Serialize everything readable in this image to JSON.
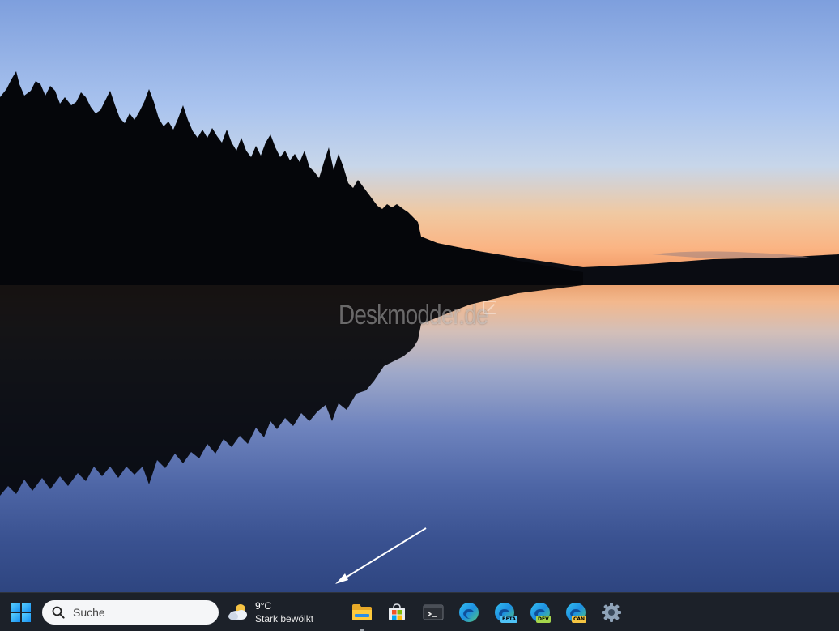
{
  "wallpaper": {
    "watermark": "Deskmodder.de",
    "colors": {
      "sky_top": "#7e9fdd",
      "horizon": "#f4a06c",
      "water_bottom": "#2e4580"
    }
  },
  "taskbar": {
    "background": "#1c2129",
    "start": {
      "icon": "windows-logo-icon"
    },
    "search": {
      "placeholder": "Suche",
      "icon": "search-icon"
    },
    "weather": {
      "temperature": "9°C",
      "condition": "Stark bewölkt",
      "icon": "cloudy-weather-icon"
    },
    "pinned_apps": [
      {
        "id": "file-explorer",
        "icon": "folder-icon",
        "running": true
      },
      {
        "id": "microsoft-store",
        "icon": "store-bag-icon"
      },
      {
        "id": "terminal",
        "icon": "terminal-icon"
      },
      {
        "id": "edge",
        "icon": "edge-icon"
      },
      {
        "id": "edge-beta",
        "icon": "edge-beta-icon",
        "badge": "BETA",
        "badge_color": "#4fc3f7"
      },
      {
        "id": "edge-dev",
        "icon": "edge-dev-icon",
        "badge": "DEV",
        "badge_color": "#a5d64c"
      },
      {
        "id": "edge-canary",
        "icon": "edge-canary-icon",
        "badge": "CAN",
        "badge_color": "#f5c542"
      },
      {
        "id": "settings",
        "icon": "gear-icon"
      }
    ]
  }
}
